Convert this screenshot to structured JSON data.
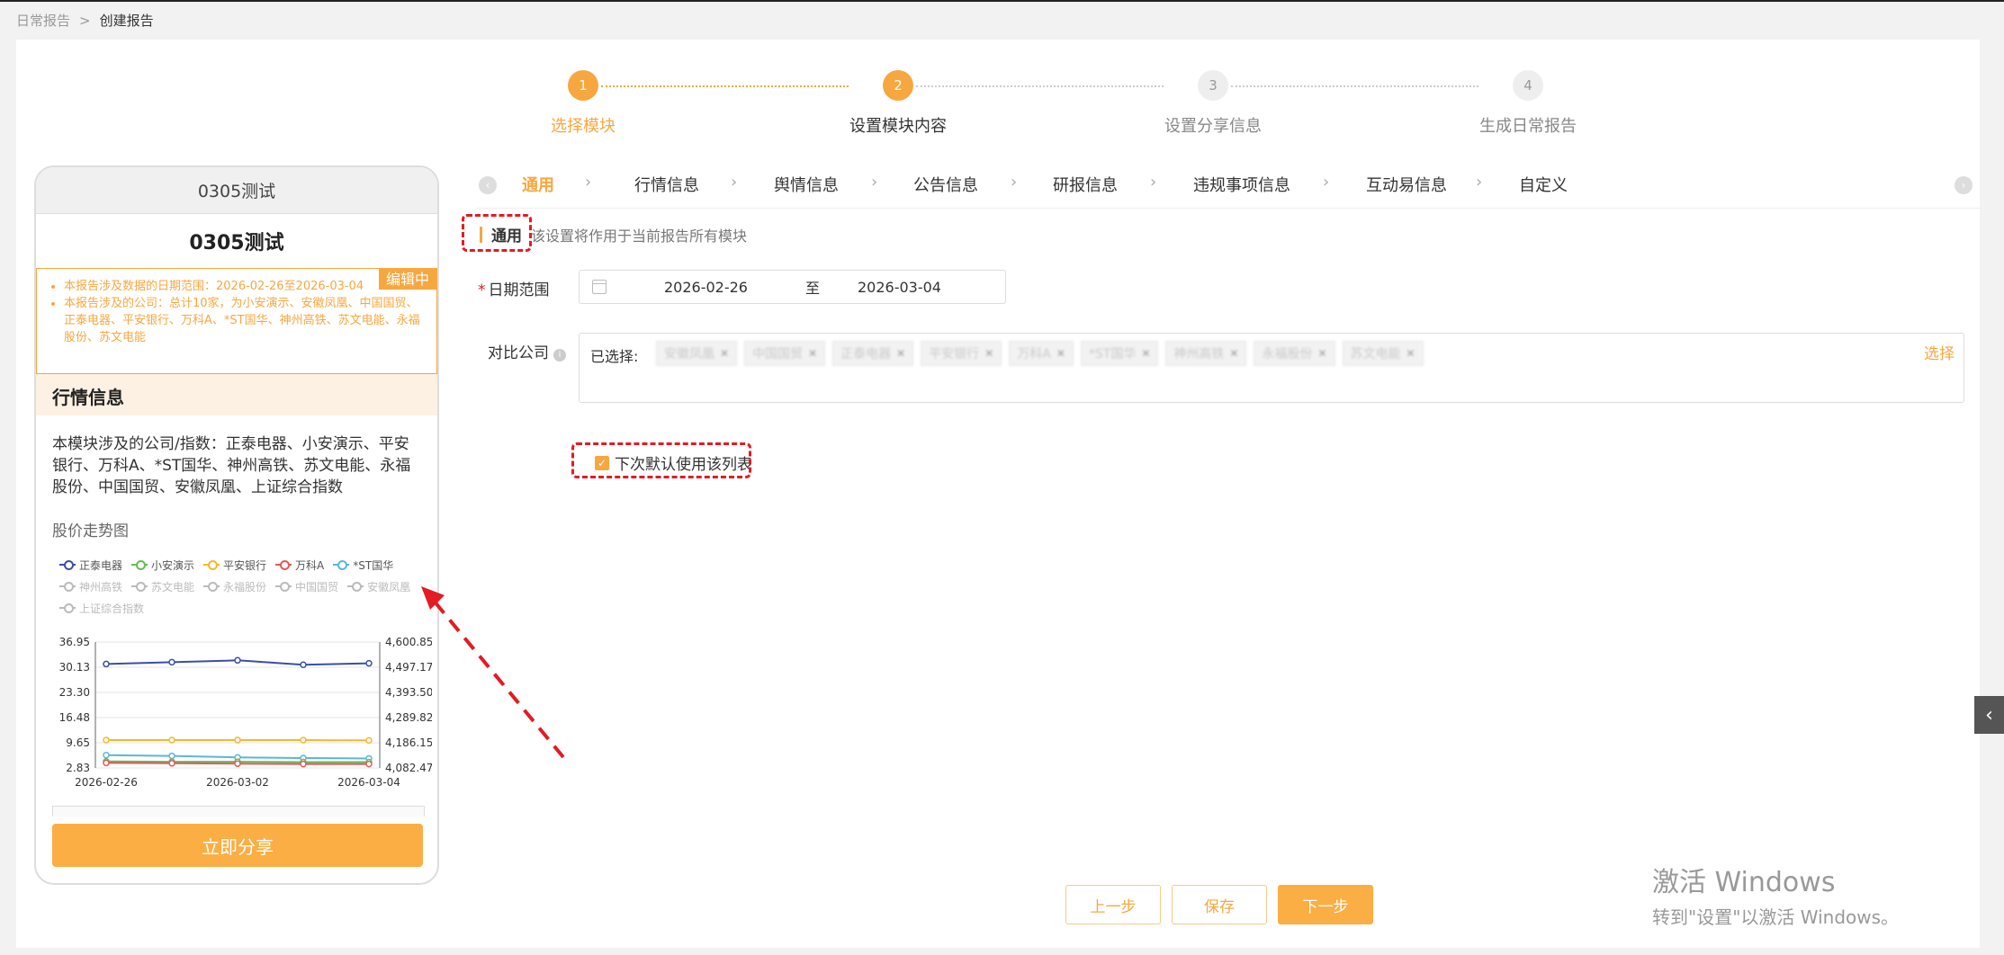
{
  "breadcrumb": {
    "parent": "日常报告",
    "sep": ">",
    "current": "创建报告"
  },
  "steps": [
    {
      "num": "1",
      "label": "选择模块",
      "state": "done"
    },
    {
      "num": "2",
      "label": "设置模块内容",
      "state": "active"
    },
    {
      "num": "3",
      "label": "设置分享信息",
      "state": "todo"
    },
    {
      "num": "4",
      "label": "生成日常报告",
      "state": "todo"
    }
  ],
  "preview": {
    "header": "0305测试",
    "title": "0305测试",
    "edit_badge": "编辑中",
    "info": [
      "本报告涉及数据的日期范围：2026-02-26至2026-03-04",
      "本报告涉及的公司：总计10家，为小安演示、安徽凤凰、中国国贸、正泰电器、平安银行、万科A、*ST国华、神州高铁、苏文电能、永福股份、苏文电能"
    ],
    "section": "行情信息",
    "module_desc": "本模块涉及的公司/指数：正泰电器、小安演示、平安银行、万科A、*ST国华、神州高铁、苏文电能、永福股份、中国国贸、安徽凤凰、上证综合指数",
    "chart_title": "股价走势图",
    "share_button": "立即分享"
  },
  "legend": [
    {
      "name": "正泰电器",
      "color": "#3b4ea8",
      "on": true
    },
    {
      "name": "小安演示",
      "color": "#66bb55",
      "on": true
    },
    {
      "name": "平安银行",
      "color": "#f5b82e",
      "on": true
    },
    {
      "name": "万科A",
      "color": "#e05a5a",
      "on": true
    },
    {
      "name": "*ST国华",
      "color": "#5ab7d8",
      "on": true
    },
    {
      "name": "神州高铁",
      "color": "#bbb",
      "on": false
    },
    {
      "name": "苏文电能",
      "color": "#bbb",
      "on": false
    },
    {
      "name": "永福股份",
      "color": "#bbb",
      "on": false
    },
    {
      "name": "中国国贸",
      "color": "#bbb",
      "on": false
    },
    {
      "name": "安徽凤凰",
      "color": "#bbb",
      "on": false
    },
    {
      "name": "上证综合指数",
      "color": "#bbb",
      "on": false
    }
  ],
  "chart_data": {
    "type": "line",
    "x": [
      "2026-02-26",
      "2026-02-27",
      "2026-03-02",
      "2026-03-03",
      "2026-03-04"
    ],
    "x_ticks": [
      "2026-02-26",
      "2026-03-02",
      "2026-03-04"
    ],
    "y_left_ticks": [
      "36.95",
      "30.13",
      "23.30",
      "16.48",
      "9.65",
      "2.83"
    ],
    "y_right_ticks": [
      "4,600.85",
      "4,497.17",
      "4,393.50",
      "4,289.82",
      "4,186.15",
      "4,082.47"
    ],
    "ylim": [
      2.83,
      36.95
    ],
    "y2lim": [
      4082.47,
      4600.85
    ],
    "series": [
      {
        "name": "正泰电器",
        "color": "#3b4ea8",
        "values": [
          31.0,
          31.5,
          32.0,
          30.8,
          31.2
        ]
      },
      {
        "name": "平安银行",
        "color": "#f5b82e",
        "values": [
          10.4,
          10.4,
          10.4,
          10.4,
          10.3
        ]
      },
      {
        "name": "*ST国华",
        "color": "#5ab7d8",
        "values": [
          6.3,
          6.1,
          5.7,
          5.5,
          5.4
        ]
      },
      {
        "name": "小安演示",
        "color": "#66bb55",
        "values": [
          4.6,
          4.5,
          4.5,
          4.4,
          4.4
        ]
      },
      {
        "name": "万科A",
        "color": "#e05a5a",
        "values": [
          4.2,
          4.1,
          4.0,
          3.9,
          3.9
        ]
      }
    ]
  },
  "tabs": {
    "items": [
      "通用",
      "行情信息",
      "舆情信息",
      "公告信息",
      "研报信息",
      "违规事项信息",
      "互动易信息",
      "自定义"
    ],
    "active": 0
  },
  "form": {
    "section_title": "通用",
    "section_hint": "该设置将作用于当前报告所有模块",
    "date_label": "日期范围",
    "date_start": "2026-02-26",
    "date_sep": "至",
    "date_end": "2026-03-04",
    "company_label": "对比公司",
    "selected_label": "已选择:",
    "chips": [
      "安徽凤凰",
      "中国国贸",
      "正泰电器",
      "平安银行",
      "万科A",
      "*ST国华",
      "神州高铁",
      "永福股份",
      "苏文电能"
    ],
    "pick_link": "选择",
    "default_checkbox": "下次默认使用该列表",
    "required_mark": "*",
    "info_mark": "i"
  },
  "buttons": {
    "prev": "上一步",
    "save": "保存",
    "next": "下一步"
  },
  "watermark": {
    "line1": "激活 Windows",
    "line2": "转到\"设置\"以激活 Windows。"
  },
  "colors": {
    "accent": "#f7a740",
    "annotation": "#e31b23"
  }
}
